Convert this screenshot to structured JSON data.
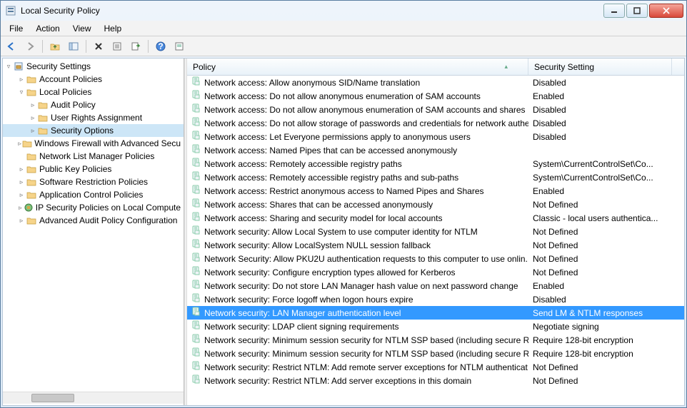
{
  "window": {
    "title": "Local Security Policy"
  },
  "menubar": [
    "File",
    "Action",
    "View",
    "Help"
  ],
  "tree": {
    "root": "Security Settings",
    "nodes": [
      {
        "label": "Account Policies",
        "depth": 1,
        "expandable": true,
        "expanded": false
      },
      {
        "label": "Local Policies",
        "depth": 1,
        "expandable": true,
        "expanded": true
      },
      {
        "label": "Audit Policy",
        "depth": 2,
        "expandable": true,
        "expanded": false
      },
      {
        "label": "User Rights Assignment",
        "depth": 2,
        "expandable": true,
        "expanded": false
      },
      {
        "label": "Security Options",
        "depth": 2,
        "expandable": true,
        "expanded": false,
        "selected": true
      },
      {
        "label": "Windows Firewall with Advanced Secu",
        "depth": 1,
        "expandable": true,
        "expanded": false
      },
      {
        "label": "Network List Manager Policies",
        "depth": 1,
        "expandable": false
      },
      {
        "label": "Public Key Policies",
        "depth": 1,
        "expandable": true,
        "expanded": false
      },
      {
        "label": "Software Restriction Policies",
        "depth": 1,
        "expandable": true,
        "expanded": false
      },
      {
        "label": "Application Control Policies",
        "depth": 1,
        "expandable": true,
        "expanded": false
      },
      {
        "label": "IP Security Policies on Local Compute",
        "depth": 1,
        "expandable": true,
        "expanded": false,
        "icon": "ipsec"
      },
      {
        "label": "Advanced Audit Policy Configuration",
        "depth": 1,
        "expandable": true,
        "expanded": false
      }
    ]
  },
  "list": {
    "columns": [
      "Policy",
      "Security Setting"
    ],
    "rows": [
      {
        "policy": "Network access: Allow anonymous SID/Name translation",
        "setting": "Disabled"
      },
      {
        "policy": "Network access: Do not allow anonymous enumeration of SAM accounts",
        "setting": "Enabled"
      },
      {
        "policy": "Network access: Do not allow anonymous enumeration of SAM accounts and shares",
        "setting": "Disabled"
      },
      {
        "policy": "Network access: Do not allow storage of passwords and credentials for network authe...",
        "setting": "Disabled"
      },
      {
        "policy": "Network access: Let Everyone permissions apply to anonymous users",
        "setting": "Disabled"
      },
      {
        "policy": "Network access: Named Pipes that can be accessed anonymously",
        "setting": ""
      },
      {
        "policy": "Network access: Remotely accessible registry paths",
        "setting": "System\\CurrentControlSet\\Co..."
      },
      {
        "policy": "Network access: Remotely accessible registry paths and sub-paths",
        "setting": "System\\CurrentControlSet\\Co..."
      },
      {
        "policy": "Network access: Restrict anonymous access to Named Pipes and Shares",
        "setting": "Enabled"
      },
      {
        "policy": "Network access: Shares that can be accessed anonymously",
        "setting": "Not Defined"
      },
      {
        "policy": "Network access: Sharing and security model for local accounts",
        "setting": "Classic - local users authentica..."
      },
      {
        "policy": "Network security: Allow Local System to use computer identity for NTLM",
        "setting": "Not Defined"
      },
      {
        "policy": "Network security: Allow LocalSystem NULL session fallback",
        "setting": "Not Defined"
      },
      {
        "policy": "Network Security: Allow PKU2U authentication requests to this computer to use onlin...",
        "setting": "Not Defined"
      },
      {
        "policy": "Network security: Configure encryption types allowed for Kerberos",
        "setting": "Not Defined"
      },
      {
        "policy": "Network security: Do not store LAN Manager hash value on next password change",
        "setting": "Enabled"
      },
      {
        "policy": "Network security: Force logoff when logon hours expire",
        "setting": "Disabled"
      },
      {
        "policy": "Network security: LAN Manager authentication level",
        "setting": "Send LM & NTLM responses",
        "selected": true
      },
      {
        "policy": "Network security: LDAP client signing requirements",
        "setting": "Negotiate signing"
      },
      {
        "policy": "Network security: Minimum session security for NTLM SSP based (including secure R...",
        "setting": "Require 128-bit encryption"
      },
      {
        "policy": "Network security: Minimum session security for NTLM SSP based (including secure R...",
        "setting": "Require 128-bit encryption"
      },
      {
        "policy": "Network security: Restrict NTLM: Add remote server exceptions for NTLM authenticat...",
        "setting": "Not Defined"
      },
      {
        "policy": "Network security: Restrict NTLM: Add server exceptions in this domain",
        "setting": "Not Defined"
      }
    ]
  }
}
